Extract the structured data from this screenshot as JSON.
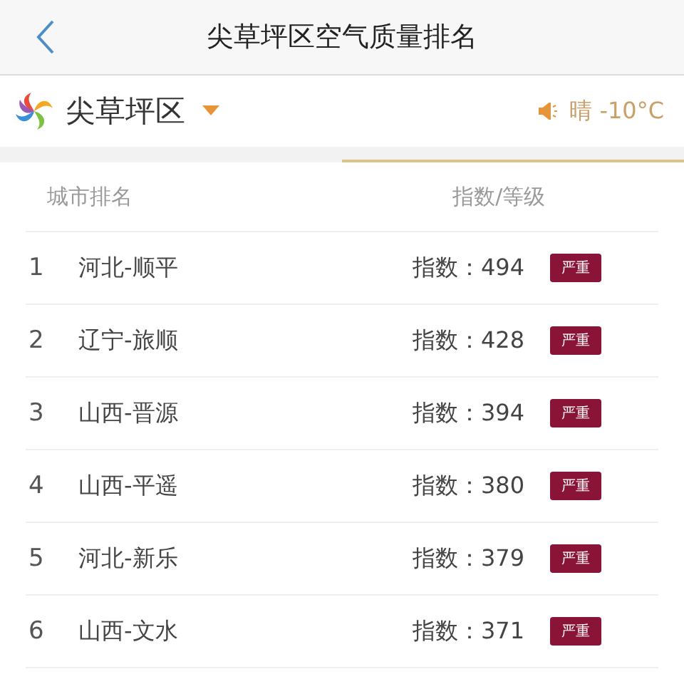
{
  "header": {
    "title": "尖草坪区空气质量排名"
  },
  "location": {
    "name": "尖草坪区",
    "weather": "晴 -10°C"
  },
  "table": {
    "columns": [
      "城市排名",
      "指数/等级"
    ],
    "rows": [
      {
        "rank": "1",
        "city": "河北-顺平",
        "index": "指数：494",
        "grade": "严重"
      },
      {
        "rank": "2",
        "city": "辽宁-旅顺",
        "index": "指数：428",
        "grade": "严重"
      },
      {
        "rank": "3",
        "city": "山西-晋源",
        "index": "指数：394",
        "grade": "严重"
      },
      {
        "rank": "4",
        "city": "山西-平遥",
        "index": "指数：380",
        "grade": "严重"
      },
      {
        "rank": "5",
        "city": "河北-新乐",
        "index": "指数：379",
        "grade": "严重"
      },
      {
        "rank": "6",
        "city": "山西-文水",
        "index": "指数：371",
        "grade": "严重"
      }
    ]
  }
}
